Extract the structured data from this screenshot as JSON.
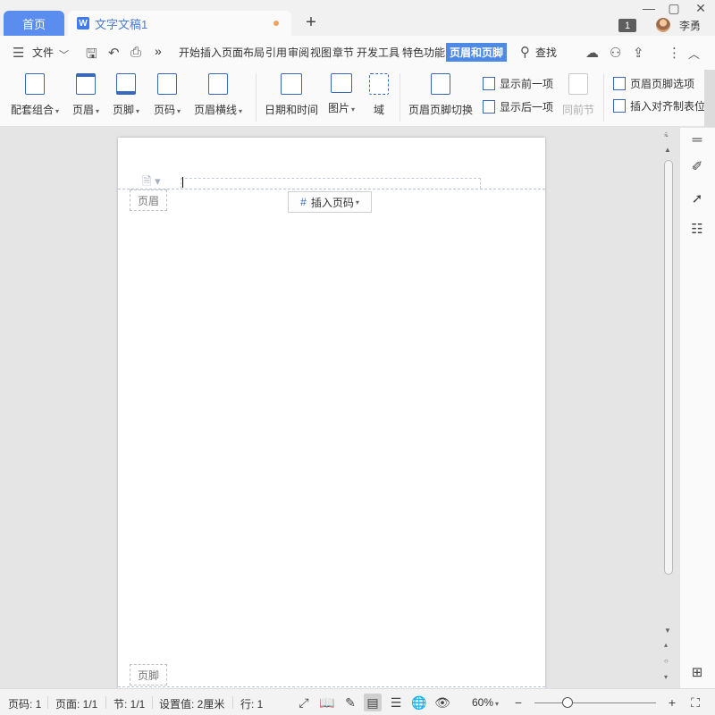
{
  "titlebar": {
    "home_tab": "首页",
    "doc_tab": "文字文稿1",
    "doc_tab_icon": "W",
    "new_tab_icon": "plus-icon",
    "window_count": "1",
    "user_name": "李勇",
    "minimize": "—",
    "maximize": "▢",
    "close": "✕"
  },
  "menubar": {
    "file_menu": "文件",
    "more": "»",
    "items": [
      "开始",
      "插入",
      "页面布局",
      "引用",
      "审阅",
      "视图",
      "章节",
      "开发工具",
      "特色功能",
      "页眉和页脚"
    ],
    "active_item": "页眉和页脚",
    "search": "查找",
    "accent_color": "#4f89e6"
  },
  "ribbon": {
    "buttons": [
      {
        "label": "配套组合",
        "dropdown": true
      },
      {
        "label": "页眉",
        "dropdown": true
      },
      {
        "label": "页脚",
        "dropdown": true
      },
      {
        "label": "页码",
        "dropdown": true
      },
      {
        "label": "页眉横线",
        "dropdown": true
      },
      {
        "label": "日期和时间",
        "dropdown": false
      },
      {
        "label": "图片",
        "dropdown": true
      },
      {
        "label": "域",
        "dropdown": false
      },
      {
        "label": "页眉页脚切换",
        "dropdown": false
      }
    ],
    "show_previous": "显示前一项",
    "show_next": "显示后一项",
    "same_as_previous": "同前节",
    "header_footer_options": "页眉页脚选项",
    "insert_align_tab": "插入对齐制表位"
  },
  "document": {
    "header_label": "页眉",
    "footer_label": "页脚",
    "insert_page_number": "插入页码"
  },
  "statusbar": {
    "page_no": "页码: 1",
    "pages": "页面: 1/1",
    "section": "节: 1/1",
    "setting": "设置值: 2厘米",
    "line": "行: 1",
    "zoom": "60%",
    "zoom_level": 0.28
  }
}
